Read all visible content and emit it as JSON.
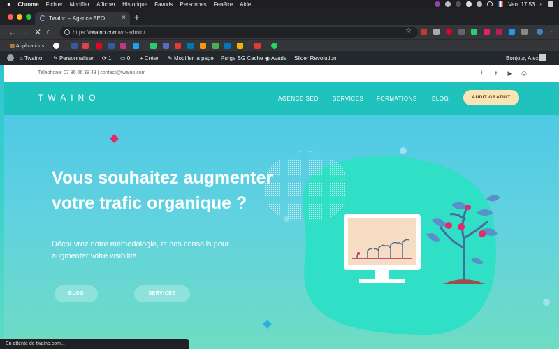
{
  "macbar": {
    "apple": "",
    "menus": [
      "Chrome",
      "Fichier",
      "Modifier",
      "Afficher",
      "Historique",
      "Favoris",
      "Personnes",
      "Fenêtre",
      "Aide"
    ],
    "clock": "Ven. 17:53"
  },
  "browser": {
    "tab_title": "Twaino – Agence SEO",
    "url_prefix": "https://",
    "url_domain": "twaino.com",
    "url_path": "/wp-admin/",
    "bookmarks_apps": "Applications",
    "status_text": "En attente de twaino.com..."
  },
  "wpbar": {
    "site_name": "Twaino",
    "customize": "Personnaliser",
    "updates": "1",
    "comments": "0",
    "new": "Créer",
    "edit_page": "Modifier la page",
    "purge": "Purge SG Cache",
    "avada": "Avada",
    "slider": "Slider Revolution",
    "greeting": "Bonjour, Alex"
  },
  "site": {
    "topinfo": "Téléphone: 07 86 06 39 48  |  contact@twaino.com",
    "logo": "TWAINO",
    "nav": [
      "AGENCE SEO",
      "SERVICES",
      "FORMATIONS",
      "BLOG"
    ],
    "cta": "AUDIT GRATUIT",
    "hero_title": "Vous souhaitez augmenter votre trafic organique ?",
    "hero_sub": "Découvrez notre méthodologie, et nos conseils pour augmenter votre visibilité",
    "btn_blog": "BLOG",
    "btn_services": "SERVICES"
  },
  "colors": {
    "nav_teal": "#1fc2bd",
    "cta_bg": "#f9e4b6",
    "pink_diamond": "#e6296b",
    "blue_diamond": "#26b3e0"
  }
}
